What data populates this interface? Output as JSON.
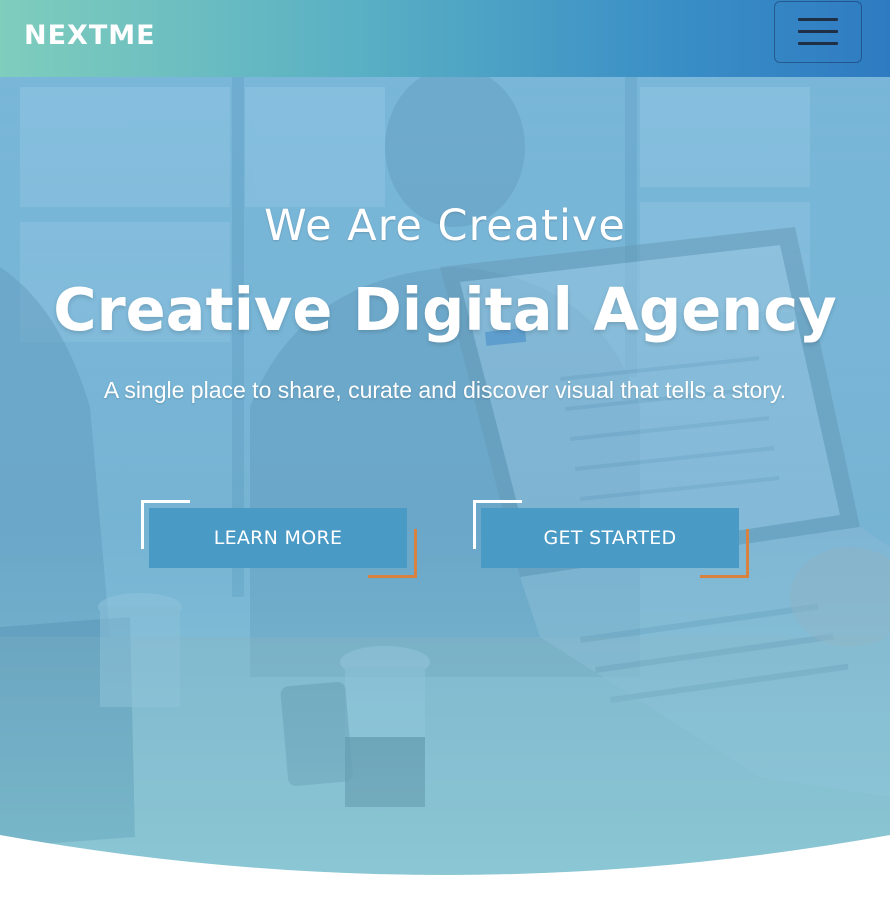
{
  "navbar": {
    "brand": "NEXTME",
    "menu_icon": "hamburger-menu-icon"
  },
  "hero": {
    "subtitle": "We Are Creative",
    "title": "Creative Digital Agency",
    "tagline": "A single place to share, curate and discover visual that tells a story.",
    "buttons": [
      {
        "label": "LEARN MORE"
      },
      {
        "label": "GET STARTED"
      }
    ]
  },
  "colors": {
    "nav_gradient_start": "#7fcdbd",
    "nav_gradient_end": "#2f7bc2",
    "button_fill": "#4a9ac6",
    "corner_accent_top": "#ffffff",
    "corner_accent_bottom": "#d9823f"
  }
}
